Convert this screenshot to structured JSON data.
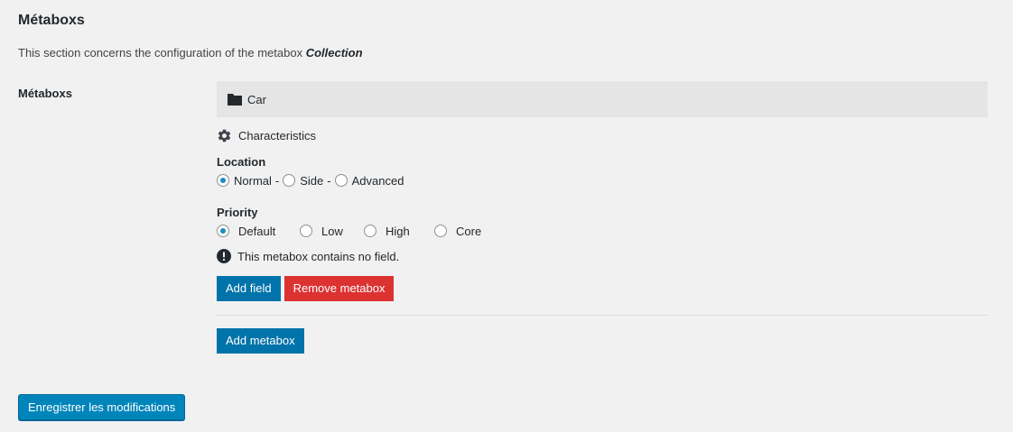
{
  "section": {
    "title": "Métaboxs",
    "description_prefix": "This section concerns the configuration of the metabox ",
    "description_emphasis": "Collection"
  },
  "row_label": "Métaboxs",
  "metabox": {
    "name": "Car",
    "icon": "folder-icon",
    "group_name": "Characteristics",
    "group_icon": "gear-icon",
    "location": {
      "label": "Location",
      "options": [
        "Normal",
        "Side",
        "Advanced"
      ],
      "separator": "-",
      "selected": "Normal"
    },
    "priority": {
      "label": "Priority",
      "options": [
        "Default",
        "Low",
        "High",
        "Core"
      ],
      "selected": "Default"
    },
    "notice": "This metabox contains no field.",
    "notice_icon": "exclamation-icon",
    "add_field_label": "Add field",
    "remove_metabox_label": "Remove metabox"
  },
  "add_metabox_label": "Add metabox",
  "save_label": "Enregistrer les modifications",
  "colors": {
    "primary_button": "#0073aa",
    "danger_button": "#dc3232",
    "save_button": "#0085ba",
    "header_background": "#e5e5e5",
    "page_background": "#f1f1f1"
  }
}
